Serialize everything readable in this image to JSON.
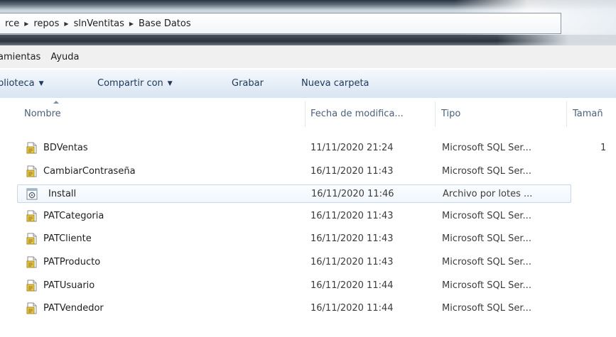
{
  "address": {
    "crumbs": [
      "rce",
      "repos",
      "slnVentitas",
      "Base Datos"
    ]
  },
  "menu": {
    "items": [
      "amientas",
      "Ayuda"
    ]
  },
  "commands": {
    "library": "blioteca",
    "share": "Compartir con",
    "burn": "Grabar",
    "new_folder": "Nueva carpeta"
  },
  "columns": {
    "name": "Nombre",
    "date": "Fecha de modifica...",
    "type": "Tipo",
    "size": "Tamañ"
  },
  "files": [
    {
      "name": "BDVentas",
      "date": "11/11/2020 21:24",
      "type": "Microsoft SQL Ser...",
      "size": "1",
      "icon": "sql-script-icon"
    },
    {
      "name": "CambiarContraseña",
      "date": "16/11/2020 11:43",
      "type": "Microsoft SQL Ser...",
      "size": "",
      "icon": "sql-script-icon"
    },
    {
      "name": "Install",
      "date": "16/11/2020 11:46",
      "type": "Archivo por lotes ...",
      "size": "",
      "icon": "batch-file-icon"
    },
    {
      "name": "PATCategoria",
      "date": "16/11/2020 11:43",
      "type": "Microsoft SQL Ser...",
      "size": "",
      "icon": "sql-script-icon"
    },
    {
      "name": "PATCliente",
      "date": "16/11/2020 11:43",
      "type": "Microsoft SQL Ser...",
      "size": "",
      "icon": "sql-script-icon"
    },
    {
      "name": "PATProducto",
      "date": "16/11/2020 11:43",
      "type": "Microsoft SQL Ser...",
      "size": "",
      "icon": "sql-script-icon"
    },
    {
      "name": "PATUsuario",
      "date": "16/11/2020 11:44",
      "type": "Microsoft SQL Ser...",
      "size": "",
      "icon": "sql-script-icon"
    },
    {
      "name": "PATVendedor",
      "date": "16/11/2020 11:44",
      "type": "Microsoft SQL Ser...",
      "size": "",
      "icon": "sql-script-icon"
    }
  ],
  "colors": {
    "selection_border": "#c6d7ec",
    "commandbar_text": "#1e395b",
    "header_text": "#4c607a"
  }
}
